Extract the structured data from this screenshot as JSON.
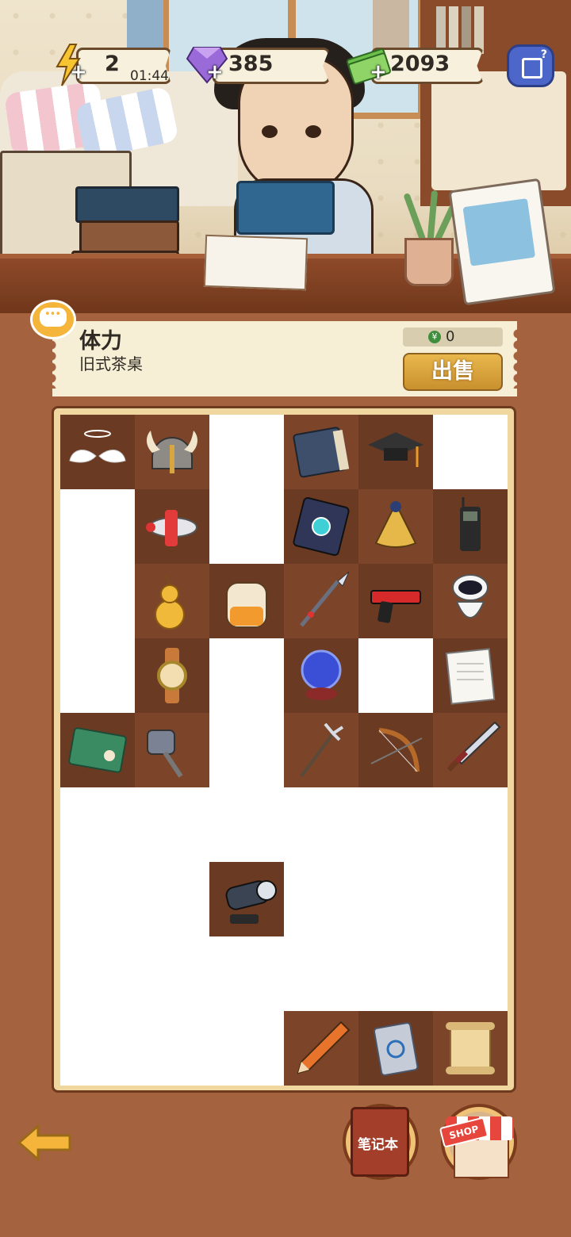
{
  "hud": {
    "energy": "2",
    "energy_timer": "01:44",
    "gems": "385",
    "cash": "2093",
    "plus": "+"
  },
  "info_panel": {
    "title": "体力",
    "subtitle": "旧式茶桌",
    "price": "0",
    "coin_symbol": "¥",
    "sell_label": "出售"
  },
  "board": {
    "columns": 6,
    "rows": 9,
    "items": [
      {
        "row": 0,
        "col": 0,
        "name": "angel-wings"
      },
      {
        "row": 0,
        "col": 1,
        "name": "viking-helmet"
      },
      {
        "row": 0,
        "col": 3,
        "name": "old-book"
      },
      {
        "row": 0,
        "col": 4,
        "name": "graduation-cap"
      },
      {
        "row": 1,
        "col": 1,
        "name": "toy-plane"
      },
      {
        "row": 1,
        "col": 3,
        "name": "magic-book"
      },
      {
        "row": 1,
        "col": 4,
        "name": "cloak"
      },
      {
        "row": 1,
        "col": 5,
        "name": "cell-phone"
      },
      {
        "row": 2,
        "col": 1,
        "name": "gourd"
      },
      {
        "row": 2,
        "col": 2,
        "name": "backpack"
      },
      {
        "row": 2,
        "col": 3,
        "name": "spear"
      },
      {
        "row": 2,
        "col": 4,
        "name": "pistol"
      },
      {
        "row": 2,
        "col": 5,
        "name": "robot"
      },
      {
        "row": 3,
        "col": 1,
        "name": "wristwatch"
      },
      {
        "row": 3,
        "col": 3,
        "name": "crystal-ball"
      },
      {
        "row": 3,
        "col": 5,
        "name": "test-paper"
      },
      {
        "row": 4,
        "col": 0,
        "name": "scroll-map"
      },
      {
        "row": 4,
        "col": 1,
        "name": "hammer"
      },
      {
        "row": 4,
        "col": 3,
        "name": "trident"
      },
      {
        "row": 4,
        "col": 4,
        "name": "bow"
      },
      {
        "row": 4,
        "col": 5,
        "name": "sword"
      },
      {
        "row": 6,
        "col": 2,
        "name": "cannon"
      },
      {
        "row": 8,
        "col": 3,
        "name": "pencil"
      },
      {
        "row": 8,
        "col": 4,
        "name": "chip"
      },
      {
        "row": 8,
        "col": 5,
        "name": "parchment"
      }
    ]
  },
  "bottom": {
    "notebook_label": "笔记本",
    "shop_label": "SHOP"
  },
  "colors": {
    "background": "#a4623f",
    "panel": "#f6efd6",
    "sell_button": "#e9b84d",
    "tile_dark": "#6b3a23",
    "tile_light": "#7c452a"
  }
}
